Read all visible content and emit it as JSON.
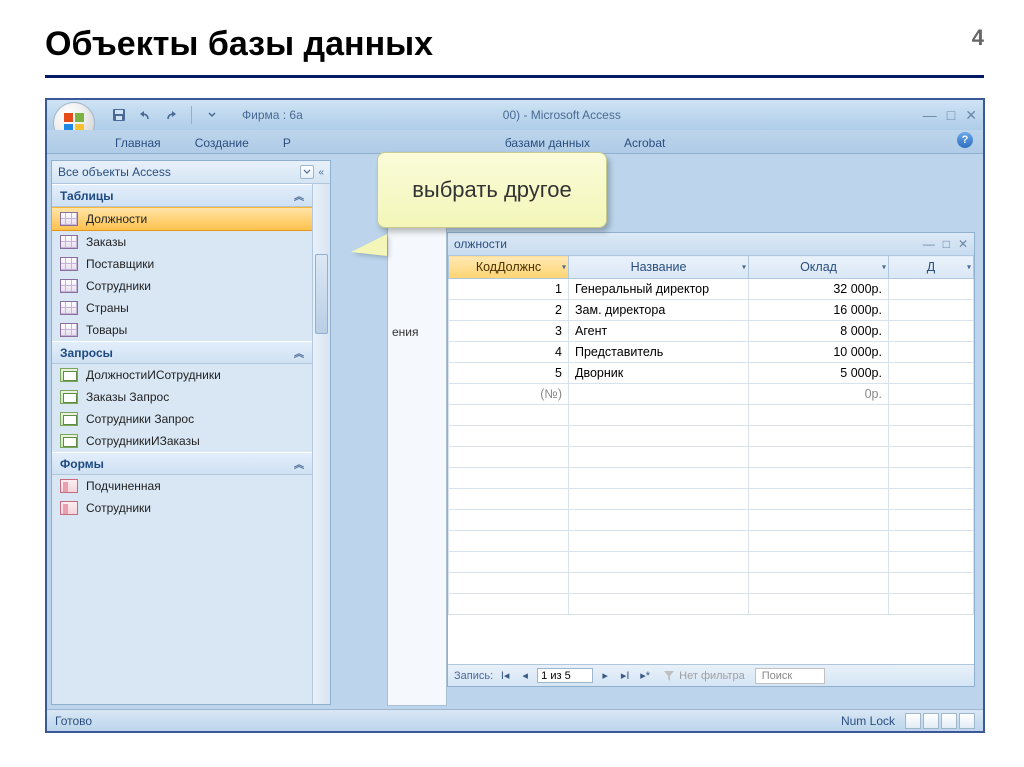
{
  "slide": {
    "title": "Объекты базы данных",
    "number": "4"
  },
  "titlebar": {
    "app_title_left": "Фирма : 6а",
    "app_title_right": "00) - Microsoft Access"
  },
  "ribbon": {
    "tabs": [
      "Главная",
      "Создание",
      "Р",
      "базами данных",
      "Acrobat"
    ]
  },
  "callout": {
    "text": "выбрать другое"
  },
  "nav": {
    "header": "Все объекты Access",
    "groups": [
      {
        "title": "Таблицы",
        "items": [
          "Должности",
          "Заказы",
          "Поставщики",
          "Сотрудники",
          "Страны",
          "Товары"
        ],
        "type": "table",
        "selected": 0
      },
      {
        "title": "Запросы",
        "items": [
          "ДолжностиИСотрудники",
          "Заказы Запрос",
          "Сотрудники Запрос",
          "СотрудникиИЗаказы"
        ],
        "type": "query"
      },
      {
        "title": "Формы",
        "items": [
          "Подчиненная",
          "Сотрудники"
        ],
        "type": "form"
      }
    ]
  },
  "sec_panel": {
    "label": "ения"
  },
  "data_window": {
    "title": "олжности",
    "columns": [
      "КодДолжнс",
      "Название",
      "Оклад",
      "Д"
    ],
    "rows": [
      {
        "id": "1",
        "name": "Генеральный директор",
        "salary": "32 000р."
      },
      {
        "id": "2",
        "name": "Зам. директора",
        "salary": "16 000р."
      },
      {
        "id": "3",
        "name": "Агент",
        "salary": "8 000р."
      },
      {
        "id": "4",
        "name": "Представитель",
        "salary": "10 000р."
      },
      {
        "id": "5",
        "name": "Дворник",
        "salary": "5 000р."
      }
    ],
    "new_row": {
      "id": "(№)",
      "salary": "0р."
    }
  },
  "record_nav": {
    "label": "Запись:",
    "pos": "1 из 5",
    "no_filter": "Нет фильтра",
    "search": "Поиск"
  },
  "statusbar": {
    "left": "Готово",
    "numlock": "Num Lock"
  }
}
